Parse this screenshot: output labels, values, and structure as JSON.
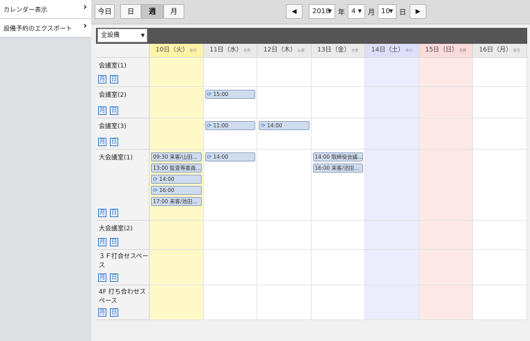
{
  "sidebar": {
    "items": [
      {
        "label": "カレンダー表示",
        "chevron": "›"
      },
      {
        "label": "設備予約のエクスポート",
        "chevron": "›"
      }
    ]
  },
  "toolbar": {
    "today": "今日",
    "day": "日",
    "week": "週",
    "month": "月",
    "prev": "◀",
    "next": "▶",
    "year": "2018",
    "year_unit": "年",
    "month_value": "4",
    "month_unit": "月",
    "day_value": "10",
    "day_unit": "日"
  },
  "facility_filter": {
    "selected": "全設備"
  },
  "columns": [
    {
      "date": "10日（火）",
      "rokuyo": "友引",
      "bg": "#fff9c8"
    },
    {
      "date": "11日（水）",
      "rokuyo": "先負",
      "bg": "#ffffff"
    },
    {
      "date": "12日（木）",
      "rokuyo": "仏滅",
      "bg": "#ffffff"
    },
    {
      "date": "13日（金）",
      "rokuyo": "大安",
      "bg": "#ffffff"
    },
    {
      "date": "14日（土）",
      "rokuyo": "赤口",
      "bg": "#ececfd"
    },
    {
      "date": "15日（日）",
      "rokuyo": "先勝",
      "bg": "#fde8e8"
    },
    {
      "date": "16日（月）",
      "rokuyo": "友引",
      "bg": "#ffffff"
    }
  ],
  "header_bg": {
    "weekday": "#eaeaea",
    "today": "#fff3a8",
    "sat": "#dedefa",
    "sun": "#fbdada"
  },
  "mini_buttons": {
    "month": "月",
    "day": "日"
  },
  "rows": [
    {
      "name": "会議室(1)",
      "events": []
    },
    {
      "name": "会議室(2)",
      "events": [
        {
          "day": 1,
          "time": "15:00",
          "title": "",
          "recurring": true
        }
      ]
    },
    {
      "name": "会議室(3)",
      "events": [
        {
          "day": 1,
          "time": "11:00",
          "title": "",
          "recurring": true
        },
        {
          "day": 2,
          "time": "14:00",
          "title": "",
          "recurring": true
        }
      ]
    },
    {
      "name": "大会議室(1)",
      "events": [
        {
          "day": 0,
          "time": "09:30",
          "title": "来客/山田…",
          "recurring": false
        },
        {
          "day": 0,
          "time": "13:00",
          "title": "監査等委員…",
          "recurring": false
        },
        {
          "day": 0,
          "time": "14:00",
          "title": "",
          "recurring": true
        },
        {
          "day": 0,
          "time": "16:00",
          "title": "",
          "recurring": true
        },
        {
          "day": 0,
          "time": "17:00",
          "title": "来客/池田…",
          "recurring": false
        },
        {
          "day": 1,
          "time": "14:00",
          "title": "",
          "recurring": true
        },
        {
          "day": 3,
          "time": "14:00",
          "title": "取締役会議…",
          "recurring": false
        },
        {
          "day": 3,
          "time": "16:00",
          "title": "来客/沼田…",
          "recurring": false
        }
      ]
    },
    {
      "name": "大会議室(2)",
      "events": []
    },
    {
      "name": "３Ｆ打合せスペース",
      "events": []
    },
    {
      "name": "4F 打ち合わせスペース",
      "events": []
    }
  ]
}
